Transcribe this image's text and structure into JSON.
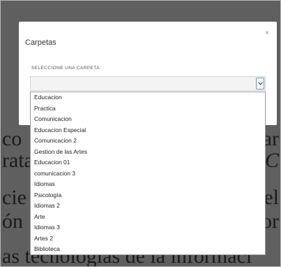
{
  "modal": {
    "title": "Carpetas",
    "close_label": "×",
    "field_label": "SELECCIONE UNA CARPETA:",
    "selected_value": ""
  },
  "dropdown": {
    "options": [
      "Educacion",
      "Practica",
      "Comunicacion",
      "Educacion Especial",
      "Comunicacion 2",
      "Gestion de las Artes",
      "Educacion 01",
      "comunicacion 3",
      "Idiomas",
      "Psicología",
      "Idiomas 2",
      "Arte",
      "Idiomas 3",
      "Artes 2",
      "Biblioteca"
    ]
  },
  "background_text": {
    "lines": [
      {
        "left": "co",
        "right": "ar"
      },
      {
        "left": "rata",
        "right": "C"
      },
      {
        "left": "cie",
        "right": "el"
      },
      {
        "left": "ón",
        "right": "or"
      },
      {
        "left": "as tecnologías de la informaci",
        "right": ""
      }
    ]
  }
}
